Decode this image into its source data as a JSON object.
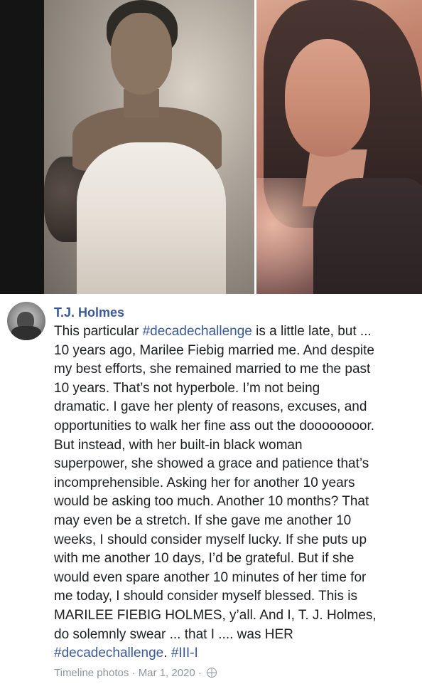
{
  "author": {
    "name": "T.J. Holmes"
  },
  "post": {
    "segments": [
      {
        "text": "This particular ",
        "type": "text"
      },
      {
        "text": "#decadechallenge",
        "type": "hashtag"
      },
      {
        "text": " is a little late, but ...\n10 years ago, Marilee Fiebig married me. And despite\nmy best efforts, she remained married to me the past\n10 years. That’s not hyperbole. I’m not being\ndramatic. I gave her plenty of reasons, excuses, and\nopportunities to walk her fine ass out the doooooooor.\nBut instead, with her built-in black woman\nsuperpower, she showed a grace and patience that’s\nincomprehensible. Asking her for another 10 years\nwould be asking too much. Another 10 months? That\nmay even be a stretch. If she gave me another 10\nweeks, I should consider myself lucky. If she puts up\nwith me another 10 days, I’d be grateful. But if she\nwould even spare another 10 minutes of her time for\nme today, I should consider myself blessed. This is\nMARILEE FIEBIG HOLMES, y’all. And I, T. J. Holmes,\ndo solemnly swear ... that I .... was HER\n",
        "type": "text"
      },
      {
        "text": "#decadechallenge",
        "type": "hashtag"
      },
      {
        "text": ". ",
        "type": "text"
      },
      {
        "text": "#III-I",
        "type": "hashtag"
      }
    ]
  },
  "footer": {
    "album": "Timeline photos",
    "separator": " · ",
    "date": "Mar 1, 2020",
    "privacy_icon": "globe-icon"
  },
  "photos": [
    {
      "name": "wedding-photo",
      "tone": "sepia"
    },
    {
      "name": "recent-portrait",
      "tone": "warm"
    }
  ]
}
